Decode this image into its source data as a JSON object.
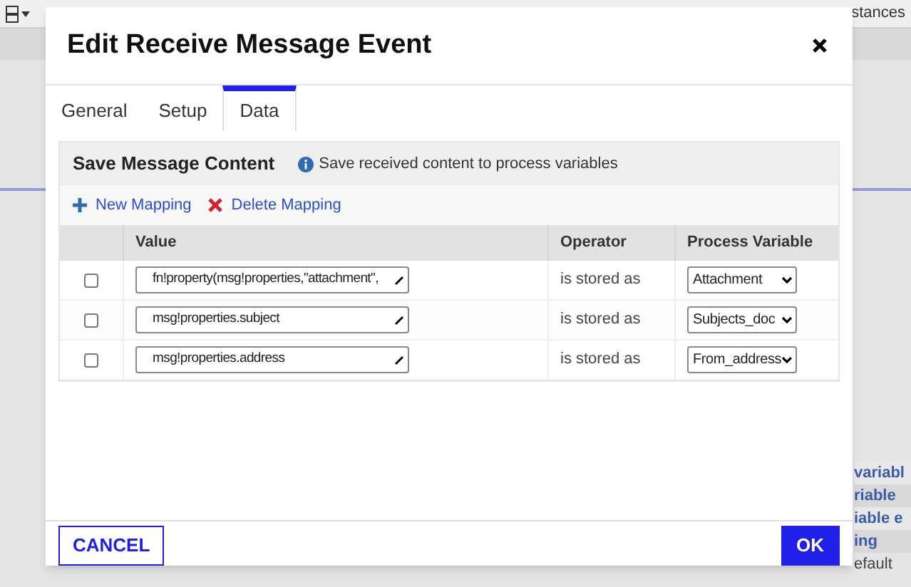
{
  "background": {
    "toolbar_text": "stances",
    "side_links": [
      "variabl",
      "riable",
      "iable e",
      "ing"
    ],
    "side_text": "efault"
  },
  "dialog": {
    "title": "Edit Receive Message Event",
    "tabs": [
      {
        "label": "General",
        "selected": false
      },
      {
        "label": "Setup",
        "selected": false
      },
      {
        "label": "Data",
        "selected": true
      }
    ],
    "section": {
      "title": "Save Message Content",
      "hint": "Save received content to process variables"
    },
    "actions": [
      {
        "kind": "add",
        "label": "New Mapping"
      },
      {
        "kind": "delete",
        "label": "Delete Mapping"
      }
    ],
    "columns": [
      "Value",
      "Operator",
      "Process Variable"
    ],
    "rows": [
      {
        "checked": false,
        "value": "fn!property(msg!properties,\"attachment\",",
        "operator": "is stored as",
        "variable": "Attachment"
      },
      {
        "checked": false,
        "value": "msg!properties.subject",
        "operator": "is stored as",
        "variable": "Subjects_doc"
      },
      {
        "checked": false,
        "value": "msg!properties.address",
        "operator": "is stored as",
        "variable": "From_address"
      }
    ],
    "buttons": [
      {
        "kind": "secondary",
        "label": "CANCEL"
      },
      {
        "kind": "primary",
        "label": "OK"
      }
    ]
  }
}
